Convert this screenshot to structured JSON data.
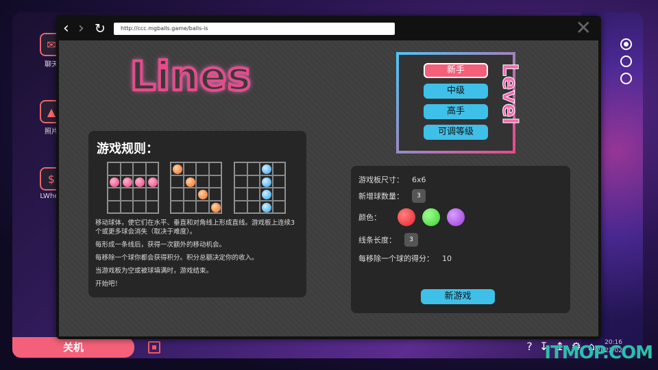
{
  "desktop": {
    "icons": [
      {
        "label": "聊天",
        "icon": "chat-icon"
      },
      {
        "label": "照片",
        "icon": "photo-icon"
      },
      {
        "label": "LWhee",
        "icon": "casino-chip-icon"
      }
    ]
  },
  "taskbar": {
    "shutdown_label": "关机",
    "clock_time": "20:16",
    "clock_date": "2022/02"
  },
  "browser": {
    "url": "http://ccc.mgballs.game/balls-is"
  },
  "game": {
    "logo": "Lines",
    "level": {
      "title": "Level",
      "options": [
        "新手",
        "中级",
        "高手",
        "可调等级"
      ],
      "selected": "新手"
    },
    "rules": {
      "title": "游戏规则：",
      "paragraphs": [
        "移动球体，使它们在水平、垂直和对角线上形成直线。游戏板上连续3个或更多球会消失（取决于难度）。",
        "每形成一条线后，获得一次额外的移动机会。",
        "每移除一个球你都会获得积分。积分总额决定你的收入。",
        "当游戏板为空或被球填满时，游戏结束。",
        "开始吧！"
      ]
    },
    "settings": {
      "board_size_label": "游戏板尺寸：",
      "board_size_value": "6x6",
      "new_balls_label": "新增球数量：",
      "new_balls_value": "3",
      "colors_label": "颜色：",
      "colors": [
        "#e8202a",
        "#38d030",
        "#9a38d8"
      ],
      "line_length_label": "线条长度：",
      "line_length_value": "3",
      "points_label": "每移除一个球的得分：",
      "points_value": "10",
      "new_game_label": "新游戏"
    }
  },
  "watermark": "ITMOP.COM"
}
